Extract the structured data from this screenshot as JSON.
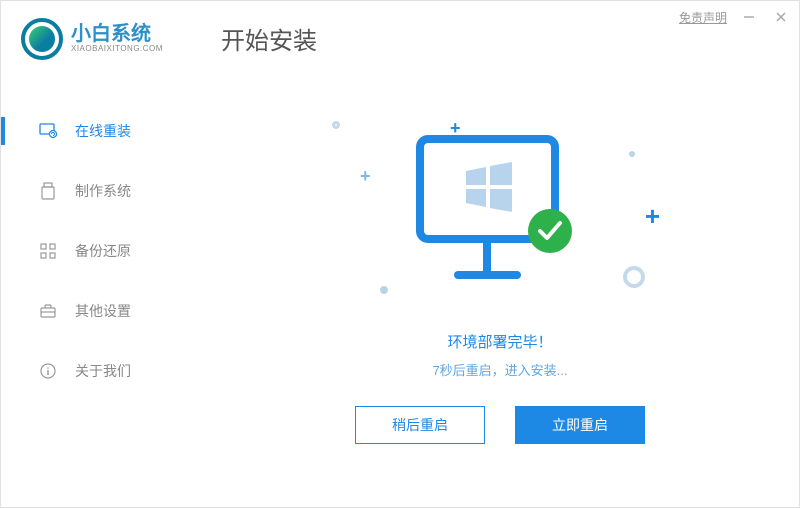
{
  "header": {
    "logo_title": "小白系统",
    "logo_sub": "XIAOBAIXITONG.COM",
    "page_title": "开始安装",
    "disclaimer": "免责声明"
  },
  "sidebar": {
    "items": [
      {
        "label": "在线重装",
        "icon": "monitor-refresh-icon",
        "active": true
      },
      {
        "label": "制作系统",
        "icon": "usb-icon",
        "active": false
      },
      {
        "label": "备份还原",
        "icon": "grid-icon",
        "active": false
      },
      {
        "label": "其他设置",
        "icon": "briefcase-icon",
        "active": false
      },
      {
        "label": "关于我们",
        "icon": "info-icon",
        "active": false
      }
    ]
  },
  "status": {
    "main": "环境部署完毕！",
    "sub": "7秒后重启，进入安装..."
  },
  "buttons": {
    "later": "稍后重启",
    "now": "立即重启"
  }
}
